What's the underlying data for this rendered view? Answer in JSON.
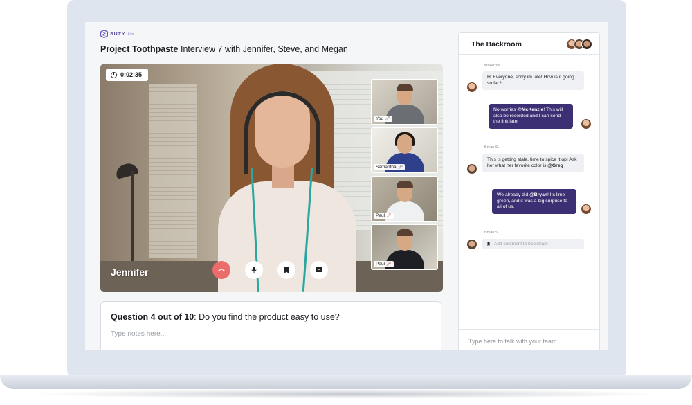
{
  "app": {
    "logo_text": "SUZY",
    "logo_sub": "Live",
    "project_title": "Project Toothpaste",
    "interview_title": "Interview 7 with Jennifer, Steve, and Megan"
  },
  "video": {
    "timer": "0:02:35",
    "speaker_name": "Jennifer",
    "controls": [
      {
        "name": "end-call",
        "icon": "phone-hangup-icon"
      },
      {
        "name": "microphone",
        "icon": "microphone-icon"
      },
      {
        "name": "bookmark",
        "icon": "bookmark-icon"
      },
      {
        "name": "screen-share",
        "icon": "screen-share-icon"
      }
    ],
    "participants": [
      {
        "label": "You",
        "mic": "on"
      },
      {
        "label": "Samantha",
        "mic": "on"
      },
      {
        "label": "Paul",
        "mic": "muted"
      },
      {
        "label": "Paul",
        "mic": "muted"
      }
    ]
  },
  "question": {
    "prefix": "Question 4 out of",
    "total": "10",
    "text": ": Do you find the product easy to use?",
    "notes_placeholder": "Type notes here..."
  },
  "chat": {
    "title": "The Backroom",
    "messages": [
      {
        "sender": "Mckenzie L.",
        "text_parts": [
          "Hi Everyone, sorry im late! How is it going so far?"
        ]
      },
      {
        "sender": "",
        "text_parts": [
          "No worries ",
          "@McKenzie",
          "! This will also be recorded and I can send the link later"
        ]
      },
      {
        "sender": "Bryan S.",
        "text_parts": [
          "This is getting stale, time to spice it up! Ask her what her favorite color is ",
          "@Greg"
        ]
      },
      {
        "sender": "",
        "text_parts": [
          "We already did ",
          "@Bryan",
          "! Its lime green, and it was a big surprise to all of us."
        ]
      }
    ],
    "bookmark_sender": "Bryan S.",
    "bookmark_placeholder": "Add comment to bookmark",
    "input_placeholder": "Type here to talk with your team...",
    "colors": {
      "outgoing_bubble": "#3d2f73",
      "incoming_bubble": "#eef0f3",
      "end_call": "#ec6b6b"
    }
  }
}
